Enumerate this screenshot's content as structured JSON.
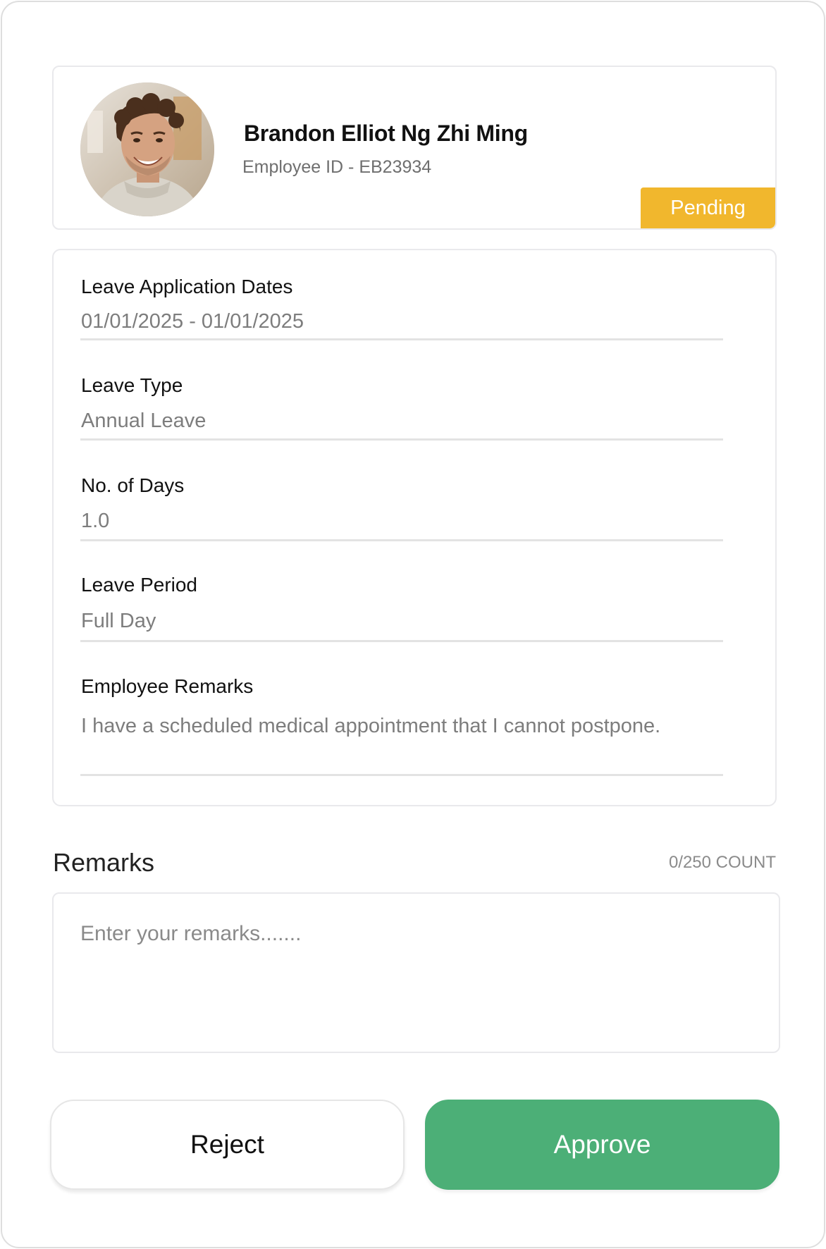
{
  "employee": {
    "name": "Brandon Elliot Ng Zhi Ming",
    "id_text": "Employee ID - EB23934",
    "status": "Pending",
    "status_color": "#f1b72d"
  },
  "details": {
    "dates": {
      "label": "Leave Application Dates",
      "value": "01/01/2025 - 01/01/2025"
    },
    "type": {
      "label": "Leave Type",
      "value": "Annual Leave"
    },
    "days": {
      "label": "No. of Days",
      "value": "1.0"
    },
    "period": {
      "label": "Leave Period",
      "value": "Full Day"
    },
    "employee_remarks": {
      "label": "Employee Remarks",
      "value": "I have a scheduled medical appointment that I cannot postpone."
    }
  },
  "remarks": {
    "title": "Remarks",
    "count": "0/250 COUNT",
    "placeholder": "Enter your remarks......."
  },
  "actions": {
    "reject_label": "Reject",
    "approve_label": "Approve",
    "approve_color": "#4caf77"
  }
}
